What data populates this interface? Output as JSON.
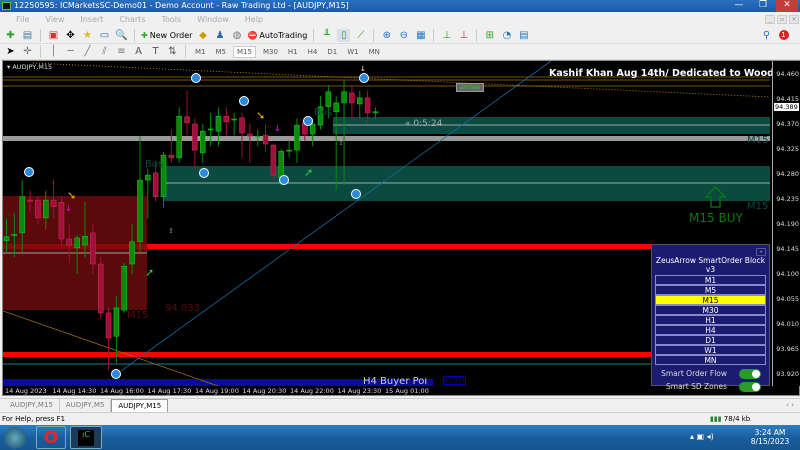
{
  "window": {
    "title": "12250595: ICMarketsSC-Demo01 - Demo Account - Raw Trading Ltd - [AUDJPY,M15]",
    "controls": [
      "—",
      "❐",
      "✕"
    ]
  },
  "menu": [
    "File",
    "View",
    "Insert",
    "Charts",
    "Tools",
    "Window",
    "Help"
  ],
  "toolbar": {
    "new_order": "New Order",
    "autotrading": "AutoTrading",
    "timeframes": [
      "M1",
      "M5",
      "M15",
      "M30",
      "H1",
      "H4",
      "D1",
      "W1",
      "MN"
    ],
    "active_timeframe": "M15",
    "notifications_badge": "1"
  },
  "chart": {
    "symbol_label": "AUDJPY,M15",
    "banner": "Kashif Khan Aug 14th/ Dedicated to Woodyz",
    "arrows_button": "arrows",
    "timer": "« 0:5:24",
    "bos_labels": [
      "Bos",
      "Bos"
    ],
    "zone_labels": {
      "m15_right_1": "M15",
      "m15_right_2": "M15",
      "m15_left": "M15",
      "level_price": "94.033",
      "buy_signal": "M15 BUY",
      "h4_zone": "H4 Buyer Poi",
      "h4_price": "93.911"
    },
    "current_price": "94.389",
    "price_ticks": [
      "94.460",
      "94.415",
      "94.370",
      "94.325",
      "94.280",
      "94.235",
      "94.190",
      "94.145",
      "94.100",
      "94.055",
      "94.010",
      "93.965",
      "93.920"
    ],
    "time_ticks": [
      "14 Aug 2023",
      "14 Aug 14:30",
      "14 Aug 16:00",
      "14 Aug 17:30",
      "14 Aug 19:00",
      "14 Aug 20:30",
      "14 Aug 22:00",
      "14 Aug 23:30",
      "15 Aug 01:00"
    ],
    "colors": {
      "bull": "#0a8a0a",
      "bear": "#a0103a",
      "supply": "#5a0a0a",
      "demand": "#0a4a40",
      "level": "#ff0000",
      "gray_level": "#9a9a9a"
    }
  },
  "chart_data": {
    "type": "candlestick",
    "ylim": [
      93.91,
      94.47
    ],
    "candles": [
      [
        94.16,
        94.167,
        94.2,
        94.14
      ],
      [
        94.17,
        94.171,
        94.21,
        94.13
      ],
      [
        94.174,
        94.239,
        94.269,
        94.14
      ],
      [
        94.233,
        94.231,
        94.25,
        94.21
      ],
      [
        94.233,
        94.201,
        94.24,
        94.19
      ],
      [
        94.201,
        94.233,
        94.25,
        94.18
      ],
      [
        94.233,
        94.221,
        94.27,
        94.2
      ],
      [
        94.229,
        94.163,
        94.24,
        94.15
      ],
      [
        94.163,
        94.152,
        94.19,
        94.12
      ],
      [
        94.147,
        94.165,
        94.17,
        94.1
      ],
      [
        94.152,
        94.168,
        94.23,
        94.13
      ],
      [
        94.174,
        94.118,
        94.19,
        94.1
      ],
      [
        94.118,
        94.03,
        94.13,
        94.02
      ],
      [
        94.03,
        93.985,
        94.04,
        93.927
      ],
      [
        93.988,
        94.039,
        94.06,
        93.94
      ],
      [
        94.035,
        94.114,
        94.12,
        94.03
      ],
      [
        94.118,
        94.158,
        94.19,
        94.1
      ],
      [
        94.158,
        94.269,
        94.348,
        94.14
      ],
      [
        94.269,
        94.278,
        94.29,
        94.2
      ],
      [
        94.282,
        94.239,
        94.3,
        94.23
      ],
      [
        94.239,
        94.314,
        94.32,
        94.22
      ],
      [
        94.314,
        94.309,
        94.36,
        94.3
      ],
      [
        94.309,
        94.384,
        94.4,
        94.3
      ],
      [
        94.383,
        94.372,
        94.43,
        94.35
      ],
      [
        94.37,
        94.323,
        94.38,
        94.29
      ],
      [
        94.318,
        94.357,
        94.37,
        94.3
      ],
      [
        94.361,
        94.361,
        94.39,
        94.33
      ],
      [
        94.357,
        94.384,
        94.4,
        94.33
      ],
      [
        94.384,
        94.374,
        94.4,
        94.35
      ],
      [
        94.379,
        94.379,
        94.39,
        94.35
      ],
      [
        94.381,
        94.354,
        94.39,
        94.31
      ],
      [
        94.352,
        94.348,
        94.37,
        94.3
      ],
      [
        94.348,
        94.348,
        94.36,
        94.33
      ],
      [
        94.35,
        94.334,
        94.37,
        94.32
      ],
      [
        94.332,
        94.278,
        94.335,
        94.27
      ],
      [
        94.273,
        94.321,
        94.325,
        94.26
      ],
      [
        94.323,
        94.323,
        94.34,
        94.31
      ],
      [
        94.323,
        94.368,
        94.38,
        94.3
      ],
      [
        94.372,
        94.352,
        94.38,
        94.34
      ],
      [
        94.352,
        94.37,
        94.38,
        94.33
      ],
      [
        94.368,
        94.401,
        94.42,
        94.36
      ],
      [
        94.401,
        94.428,
        94.44,
        94.38
      ],
      [
        94.392,
        94.408,
        94.42,
        94.251
      ],
      [
        94.408,
        94.428,
        94.449,
        94.26
      ],
      [
        94.426,
        94.408,
        94.44,
        94.38
      ],
      [
        94.406,
        94.417,
        94.43,
        94.38
      ],
      [
        94.417,
        94.39,
        94.43,
        94.37
      ],
      [
        94.39,
        94.392,
        94.4,
        94.38
      ]
    ]
  },
  "panel": {
    "title": "ZeusArrow SmartOrder Block v3",
    "minimize": "-",
    "timeframes": [
      "M1",
      "M5",
      "M15",
      "M30",
      "H1",
      "H4",
      "D1",
      "W1",
      "MN"
    ],
    "selected": "M15",
    "toggles": [
      {
        "label": "Smart Order Flow",
        "on": true
      },
      {
        "label": "Smart SD Zones",
        "on": true
      }
    ]
  },
  "tabs": [
    "AUDJPY,M15",
    "AUDJPY,M5",
    "AUDJPY,M15"
  ],
  "active_tab": 2,
  "status": {
    "help": "For Help, press F1",
    "traffic": "78/4 kb"
  },
  "taskbar": {
    "time": "3:24 AM",
    "date": "8/15/2023"
  }
}
